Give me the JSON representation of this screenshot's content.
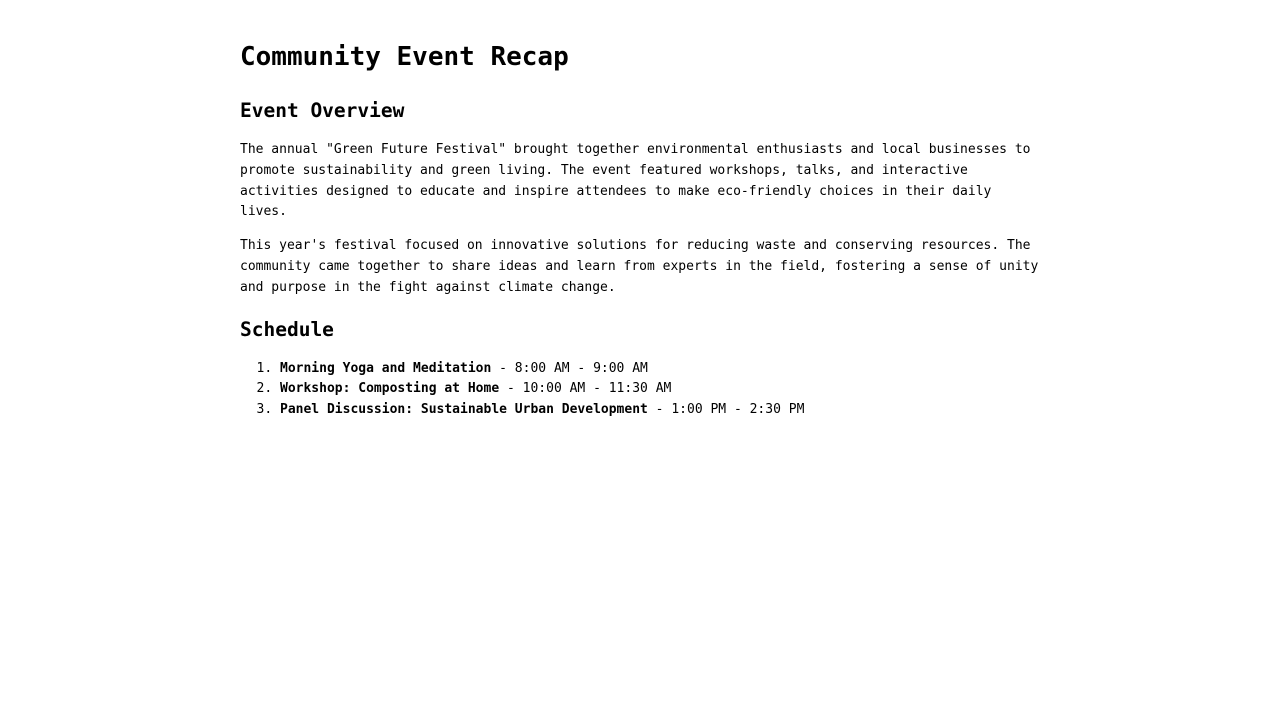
{
  "title": "Community Event Recap",
  "overview": {
    "heading": "Event Overview",
    "paragraphs": [
      "The annual \"Green Future Festival\" brought together environmental enthusiasts and local businesses to promote sustainability and green living. The event featured workshops, talks, and interactive activities designed to educate and inspire attendees to make eco-friendly choices in their daily lives.",
      "This year's festival focused on innovative solutions for reducing waste and conserving resources. The community came together to share ideas and learn from experts in the field, fostering a sense of unity and purpose in the fight against climate change."
    ]
  },
  "schedule": {
    "heading": "Schedule",
    "items": [
      {
        "name": "Morning Yoga and Meditation",
        "time": " - 8:00 AM - 9:00 AM"
      },
      {
        "name": "Workshop: Composting at Home",
        "time": " - 10:00 AM - 11:30 AM"
      },
      {
        "name": "Panel Discussion: Sustainable Urban Development",
        "time": " - 1:00 PM - 2:30 PM"
      }
    ]
  }
}
